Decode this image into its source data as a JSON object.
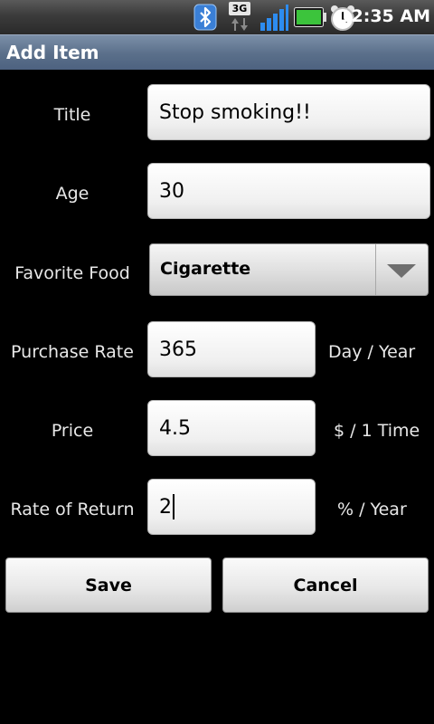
{
  "status_bar": {
    "time": "12:35 AM",
    "network_label": "3G",
    "icons": [
      "bluetooth-icon",
      "3g-data-icon",
      "signal-icon",
      "battery-icon",
      "alarm-clock-icon"
    ],
    "battery_color": "#3cc43c"
  },
  "titlebar": {
    "title": "Add Item"
  },
  "form": {
    "title_label": "Title",
    "title_value": "Stop smoking!!",
    "age_label": "Age",
    "age_value": "30",
    "food_label": "Favorite Food",
    "food_value": "Cigarette",
    "purchase_label": "Purchase Rate",
    "purchase_value": "365",
    "purchase_unit": "Day / Year",
    "price_label": "Price",
    "price_value": "4.5",
    "price_unit": "$ / 1 Time",
    "return_label": "Rate of Return",
    "return_value": "2",
    "return_unit": "% / Year"
  },
  "actions": {
    "save_label": "Save",
    "cancel_label": "Cancel"
  }
}
